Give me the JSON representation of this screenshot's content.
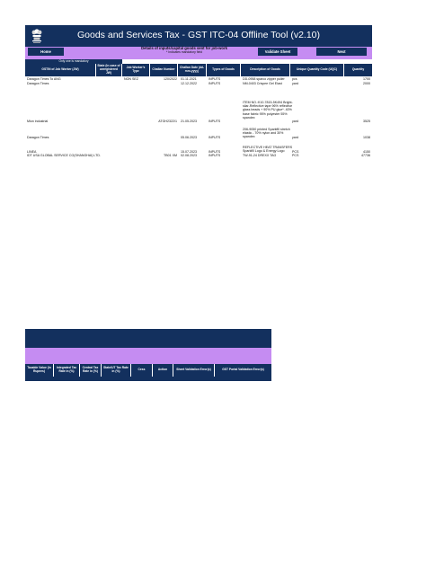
{
  "header": {
    "title": "Goods and Services Tax - GST ITC-04 Offline Tool (v2.10)",
    "emblem_icon": "india-emblem-icon"
  },
  "toolbar": {
    "home_label": "Home",
    "validate_label": "Validate Sheet",
    "next_label": "Next",
    "subtitle": "Details of inputs/capital goods sent for job-work",
    "subnote": "* Indicates mandatory field"
  },
  "note": "Only one is mandatory",
  "table": {
    "columns": [
      "GSTIN of Job Worker (JW)",
      "State (in case of unregistered JW)",
      "Job Worker's Type",
      "Challan Number",
      "Challan Date (dd-mm-yyyy)",
      "Types of Goods",
      "Description of Goods",
      "Unique Quantity Code (UQC)",
      "Quantity"
    ],
    "rows": [
      {
        "gstin": "Daragon Times  To ANG",
        "state": "",
        "jwtype": "NON SEZ",
        "challan_no": "120/2022",
        "date": "01.11.2021",
        "type": "INPUTS",
        "desc": "DD-0958 sparco zipper puller",
        "uqc": "pcs",
        "qty": "1700"
      },
      {
        "gstin": "Daragon Times",
        "state": "",
        "jwtype": "",
        "challan_no": "",
        "date": "12.12.2022",
        "type": "INPUTS",
        "desc": "NM-0403 Crispee Gel Elast",
        "uqc": "yard",
        "qty": "2000"
      },
      {
        "gstin": "Mion industrial",
        "state": "",
        "jwtype": "",
        "challan_no": "ATGH2322/1",
        "date": "21.05.2023",
        "type": "INPUTS",
        "desc": "ITEM NO.:K10-7815-5K494 Bright-silar-Reflective tape 96% reflective glass beads + 90% PU glue*. 40% base fabric 95% polyester 55% spandex",
        "uqc": "yard",
        "qty": "3525"
      },
      {
        "gstin": "Daragon Times",
        "state": "",
        "jwtype": "",
        "challan_no": "",
        "date": "05.06.2023",
        "type": "INPUTS",
        "desc": "206-9050 printed Sparkfill stretch elastic - 70% nylon and 30% spandex",
        "uqc": "yard",
        "qty": "1038"
      },
      {
        "gstin": "LINEA",
        "state": "",
        "jwtype": "",
        "challan_no": "",
        "date": "15.07.2023",
        "type": "INPUTS",
        "desc": "REFLECTIVE HEAT TRANSFERS Sparkfill Logo & Energy Logo",
        "uqc": "PCS",
        "qty": "4150"
      },
      {
        "gstin": "IDT USA GLOBAL SERVICE CO(SHANGHAI) LTD.",
        "state": "",
        "jwtype": "",
        "challan_no": "TB01 XM",
        "date": "02.08.2023",
        "type": "INPUTS",
        "desc": "TW-91-24 DREXX TAG",
        "uqc": "PCS",
        "qty": "47736"
      }
    ]
  },
  "lower_table": {
    "columns": [
      "Taxable Value (In Rupees)",
      "Integrated Tax Rate in (%)",
      "Central Tax Rate in (%)",
      "State/UT Tax Rate in (%)",
      "Cess",
      "Action",
      "Sheet Validation Error(s)",
      "GST Portal Validation Error(s)"
    ]
  }
}
